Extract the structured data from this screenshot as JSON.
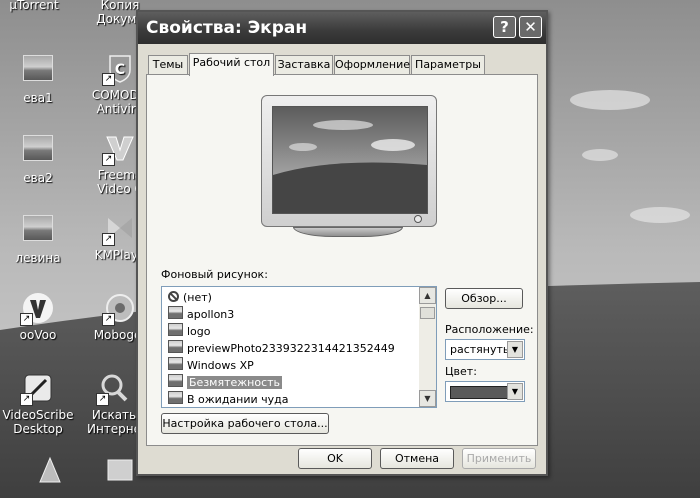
{
  "desktop": {
    "icons": [
      {
        "name": "desktop-icon-utorrent",
        "label": "µTorrent",
        "kind": "app"
      },
      {
        "name": "desktop-icon-copy-docs",
        "label": "Копия\nДокуме",
        "kind": "folder"
      },
      {
        "name": "desktop-icon-eva1",
        "label": "ева1",
        "kind": "image"
      },
      {
        "name": "desktop-icon-comodo",
        "label": "COMODO\nAntiviru",
        "kind": "app"
      },
      {
        "name": "desktop-icon-eva2",
        "label": "ева2",
        "kind": "image"
      },
      {
        "name": "desktop-icon-freemake",
        "label": "Freema\nVideo C",
        "kind": "app"
      },
      {
        "name": "desktop-icon-levina",
        "label": "левина",
        "kind": "image"
      },
      {
        "name": "desktop-icon-kmplayer",
        "label": "KMPlaye",
        "kind": "app"
      },
      {
        "name": "desktop-icon-oovoo",
        "label": "ooVoo",
        "kind": "app"
      },
      {
        "name": "desktop-icon-mobogenie",
        "label": "Moboger",
        "kind": "app"
      },
      {
        "name": "desktop-icon-videoscribe",
        "label": "VideoScribe\nDesktop",
        "kind": "app"
      },
      {
        "name": "desktop-icon-search-internet",
        "label": "Искать\nИнтерне",
        "kind": "app"
      }
    ]
  },
  "dialog": {
    "title": "Свойства: Экран",
    "help_button": "?",
    "close_button": "✕",
    "tabs": [
      {
        "label": "Темы",
        "active": false
      },
      {
        "label": "Рабочий стол",
        "active": true
      },
      {
        "label": "Заставка",
        "active": false
      },
      {
        "label": "Оформление",
        "active": false
      },
      {
        "label": "Параметры",
        "active": false
      }
    ],
    "background_label": "Фоновый рисунок:",
    "backgrounds": [
      {
        "label": "(нет)",
        "icon": "none-icon",
        "selected": false
      },
      {
        "label": "apollon3",
        "icon": "image-icon",
        "selected": false
      },
      {
        "label": "logo",
        "icon": "image-icon",
        "selected": false
      },
      {
        "label": "previewPhoto2339322314421352449",
        "icon": "image-icon",
        "selected": false
      },
      {
        "label": "Windows XP",
        "icon": "image-icon",
        "selected": false
      },
      {
        "label": "Безмятежность",
        "icon": "image-icon",
        "selected": true
      },
      {
        "label": "В ожидании чуда",
        "icon": "image-icon",
        "selected": false
      }
    ],
    "browse_button": "Обзор...",
    "position_label": "Расположение:",
    "position_value": "растянуть",
    "color_label": "Цвет:",
    "color_value": "#5a5a5a",
    "customize_button": "Настройка рабочего стола...",
    "ok_button": "OK",
    "cancel_button": "Отмена",
    "apply_button": "Применить"
  }
}
